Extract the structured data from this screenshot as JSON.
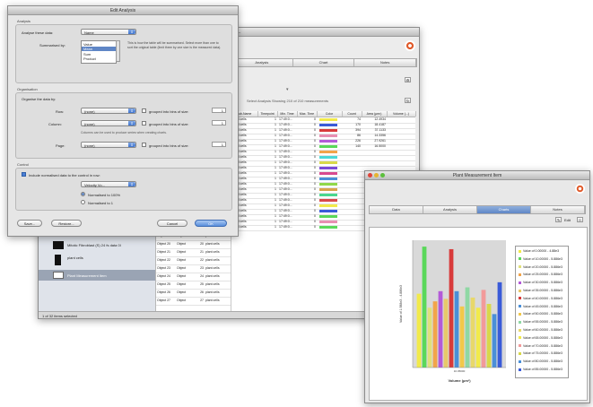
{
  "main_window": {
    "title": "Leg (Leg) ...",
    "tabs": [
      {
        "label": "Analysis",
        "selected": true
      },
      {
        "label": "Chart",
        "selected": false
      },
      {
        "label": "Notes",
        "selected": false
      }
    ],
    "info_text": "Select Analysis    Showing 210 of 210 measurements",
    "table_headers": [
      "Sub-Name",
      "Timepoint",
      "Min. Time",
      "Max. Time",
      "Color",
      "Count",
      "Area (µm²)",
      "Volume (...)"
    ],
    "rows": [
      {
        "name": "plant cells",
        "tp": "1",
        "t": "17:49:0...",
        "n": "0",
        "v1": "74",
        "v2": "12.4934",
        "color": "#f2ea4a"
      },
      {
        "name": "plant cells",
        "tp": "1",
        "t": "17:49:0...",
        "n": "0",
        "v1": "170",
        "v2": "18.4187",
        "color": "#3a5bd8"
      },
      {
        "name": "plant cells",
        "tp": "1",
        "t": "17:49:0...",
        "n": "0",
        "v1": "394",
        "v2": "37.1133",
        "color": "#d83a3a"
      },
      {
        "name": "plant cells",
        "tp": "1",
        "t": "17:49:0...",
        "n": "0",
        "v1": "86",
        "v2": "14.3356",
        "color": "#e88fb2"
      },
      {
        "name": "plant cells",
        "tp": "1",
        "t": "17:49:0...",
        "n": "0",
        "v1": "226",
        "v2": "27.9261",
        "color": "#b35ad8"
      },
      {
        "name": "plant cells",
        "tp": "1",
        "t": "17:49:0...",
        "n": "0",
        "v1": "140",
        "v2": "16.5000",
        "color": "#5ad85a"
      },
      {
        "name": "plant cells",
        "tp": "1",
        "t": "17:49:0...",
        "n": "0",
        "v1": "",
        "v2": "",
        "color": "#f2a44a"
      },
      {
        "name": "plant cells",
        "tp": "1",
        "t": "17:49:0...",
        "n": "0",
        "v1": "",
        "v2": "",
        "color": "#4ad8d8"
      },
      {
        "name": "plant cells",
        "tp": "1",
        "t": "17:49:0...",
        "n": "0",
        "v1": "",
        "v2": "",
        "color": "#d8d84a"
      },
      {
        "name": "plant cells",
        "tp": "1",
        "t": "17:49:0...",
        "n": "0",
        "v1": "",
        "v2": "",
        "color": "#7a4ad8"
      },
      {
        "name": "plant cells",
        "tp": "1",
        "t": "17:49:0...",
        "n": "0",
        "v1": "",
        "v2": "",
        "color": "#d84a8f"
      },
      {
        "name": "plant cells",
        "tp": "1",
        "t": "17:49:0...",
        "n": "0",
        "v1": "",
        "v2": "",
        "color": "#4a8fd8"
      },
      {
        "name": "plant cells",
        "tp": "1",
        "t": "17:49:0...",
        "n": "0",
        "v1": "",
        "v2": "",
        "color": "#8fd84a"
      },
      {
        "name": "plant cells",
        "tp": "1",
        "t": "17:49:0...",
        "n": "0",
        "v1": "",
        "v2": "",
        "color": "#d8a44a"
      },
      {
        "name": "plant cells",
        "tp": "1",
        "t": "17:49:0...",
        "n": "0",
        "v1": "",
        "v2": "",
        "color": "#4ad88f"
      },
      {
        "name": "plant cells",
        "tp": "1",
        "t": "17:49:0...",
        "n": "0",
        "v1": "",
        "v2": "",
        "color": "#d84a4a"
      },
      {
        "name": "plant cells",
        "tp": "1",
        "t": "17:49:0...",
        "n": "0",
        "v1": "",
        "v2": "",
        "color": "#f2ea4a"
      },
      {
        "name": "plant cells",
        "tp": "1",
        "t": "17:49:0...",
        "n": "0",
        "v1": "",
        "v2": "",
        "color": "#3a5bd8"
      },
      {
        "name": "plant cells",
        "tp": "1",
        "t": "17:49:0...",
        "n": "0",
        "v1": "",
        "v2": "",
        "color": "#5ad85a"
      },
      {
        "name": "plant cells",
        "tp": "1",
        "t": "17:49:0...",
        "n": "0",
        "v1": "",
        "v2": "",
        "color": "#e88fb2"
      },
      {
        "name": "plant cells",
        "tp": "1",
        "t": "17:49:0...",
        "n": "0",
        "v1": "",
        "v2": "",
        "color": "#5ad85a"
      }
    ],
    "lower_rows": [
      {
        "obj": "Object 19",
        "kind": "Object",
        "n": "19",
        "name": "plant cells"
      },
      {
        "obj": "Object 20",
        "kind": "Object",
        "n": "20",
        "name": "plant cells"
      },
      {
        "obj": "Object 21",
        "kind": "Object",
        "n": "21",
        "name": "plant cells"
      },
      {
        "obj": "Object 22",
        "kind": "Object",
        "n": "22",
        "name": "plant cells"
      },
      {
        "obj": "Object 23",
        "kind": "Object",
        "n": "23",
        "name": "plant cells"
      },
      {
        "obj": "Object 24",
        "kind": "Object",
        "n": "24",
        "name": "plant cells"
      },
      {
        "obj": "Object 25",
        "kind": "Object",
        "n": "25",
        "name": "plant cells"
      },
      {
        "obj": "Object 26",
        "kind": "Object",
        "n": "26",
        "name": "plant cells"
      },
      {
        "obj": "Object 27",
        "kind": "Object",
        "n": "27",
        "name": "plant cells"
      }
    ],
    "sidebar_items": [
      {
        "label": "Mitotic Fibroblast (S) 24 fs data 0l",
        "selected": false
      },
      {
        "label": "plant cells",
        "selected": false
      },
      {
        "label": "Plant Measurement Item",
        "selected": true
      }
    ],
    "status_text": "1 of 32 items selected"
  },
  "dialog": {
    "title": "Edit Analysis",
    "analysis_section": "Analysis",
    "analyse_label": "Analyse these data:",
    "analyse_value": "Name",
    "summarised_label": "Summarised by:",
    "summarised_options": [
      "Value",
      "Mean",
      "Sum",
      "Product"
    ],
    "summarised_selected": 1,
    "help_text": "This is how the table will be summarised. Select more than one to sort the original table (limit three by one size is the measured data).",
    "organisation_section": "Organisation",
    "organise_label": "Organise the data by:",
    "row_label": "Row:",
    "row_value": "(none)",
    "column_label": "Column:",
    "column_value": "(none)",
    "page_label": "Page:",
    "page_value": "(none)",
    "grouped_label": "grouped into bins of size:",
    "grouped_value": "1",
    "column_note": "Columns can be used to produce series when creating charts.",
    "control_section": "Control",
    "include_label": "Include normalised data to the control in row:",
    "control_value": "Velocity Vo...",
    "normalised_100": "Normalised to 100%",
    "normalised_1": "Normalised to 1",
    "save_label": "Save...",
    "restore_label": "Restore...",
    "cancel_label": "Cancel",
    "ok_label": "OK"
  },
  "chart_window": {
    "title": "Plant Measurement Item",
    "tabs": [
      {
        "label": "Data",
        "selected": false
      },
      {
        "label": "Analysis",
        "selected": false
      },
      {
        "label": "Charts",
        "selected": true
      },
      {
        "label": "Notes",
        "selected": false
      }
    ],
    "tool_labels": [
      "Edit",
      "Edit"
    ]
  },
  "chart_data": {
    "type": "bar",
    "xlabel": "Volume (µm³)",
    "ylabel": "Value of 1.988e3 - 4.886e3",
    "categories": [
      "10.05000"
    ],
    "legend_position": "right",
    "series": [
      {
        "name": "Value of 0.00000 - 4.88e3",
        "value": 58,
        "color": "#f2ea4a"
      },
      {
        "name": "Value of 10.00000 - 5.886e3",
        "value": 95,
        "color": "#5ad85a"
      },
      {
        "name": "Value of 20.00000 - 5.886e3",
        "value": 47,
        "color": "#e0e07a"
      },
      {
        "name": "Value of 25.00000 - 5.886e3",
        "value": 52,
        "color": "#f2a44a"
      },
      {
        "name": "Value of 30.00000 - 5.886e3",
        "value": 60,
        "color": "#b35ad8"
      },
      {
        "name": "Value of 35.00000 - 5.886e3",
        "value": 54,
        "color": "#e8c86a"
      },
      {
        "name": "Value of 40.00000 - 5.886e3",
        "value": 93,
        "color": "#d83a3a"
      },
      {
        "name": "Value of 45.00000 - 5.886e3",
        "value": 60,
        "color": "#4a8fd8"
      },
      {
        "name": "Value of 50.00000 - 5.886e3",
        "value": 48,
        "color": "#f2c84a"
      },
      {
        "name": "Value of 55.00000 - 5.886e3",
        "value": 63,
        "color": "#8fd8a4"
      },
      {
        "name": "Value of 60.00000 - 5.886e3",
        "value": 55,
        "color": "#e8d86a"
      },
      {
        "name": "Value of 65.00000 - 5.886e3",
        "value": 47,
        "color": "#f2ea4a"
      },
      {
        "name": "Value of 70.00000 - 5.886e3",
        "value": 61,
        "color": "#f29a9a"
      },
      {
        "name": "Value of 75.00000 - 5.886e3",
        "value": 50,
        "color": "#d8d84a"
      },
      {
        "name": "Value of 80.00000 - 5.886e3",
        "value": 42,
        "color": "#4a8fd8"
      },
      {
        "name": "Value of 85.00000 - 5.886e3",
        "value": 67,
        "color": "#3a5bd8"
      }
    ],
    "ylim": [
      0,
      100
    ],
    "grid": false
  },
  "colors": {
    "selection_blue": "#5f86c6",
    "chart_bg": "#d9d9d9"
  }
}
